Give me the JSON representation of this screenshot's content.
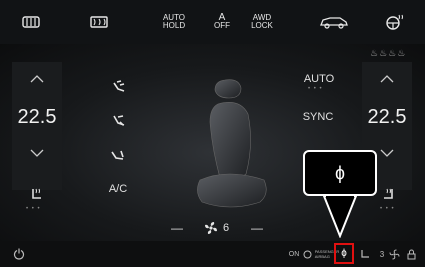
{
  "top_bar": {
    "rear_defrost_icon": "rear-defrost-icon",
    "front_defrost_icon": "front-defrost-icon",
    "auto_hold": "AUTO\nHOLD",
    "auto_hold_sub": "",
    "a_off": "OFF",
    "a_letter": "A",
    "awd_lock": "AWD\nLOCK",
    "car_icon": "vehicle-icon",
    "heated_wheel_icon": "heated-steering-icon"
  },
  "left": {
    "temperature": "22.5",
    "up": "︿",
    "down": "﹀"
  },
  "right": {
    "temperature": "22.5",
    "up": "︿",
    "down": "﹀",
    "auto_label": "AUTO",
    "sync_label": "SYNC",
    "seat_heat_levels": "♨♨♨♨"
  },
  "center": {
    "ac_label": "A/C",
    "fan_speed": "6",
    "minus": "—",
    "plus": "—"
  },
  "callout": {
    "wireless_charge_symbol": "ɸ"
  },
  "bottom_bar": {
    "power_icon": "power-icon",
    "passenger_airbag": "ON",
    "passenger_airbag_text": "PASSENGER\nAIRBAG",
    "wireless_charge_symbol": "ɸ",
    "rear_label": "3"
  },
  "colors": {
    "highlight": "#e01010",
    "callout_border": "#ffffff"
  }
}
